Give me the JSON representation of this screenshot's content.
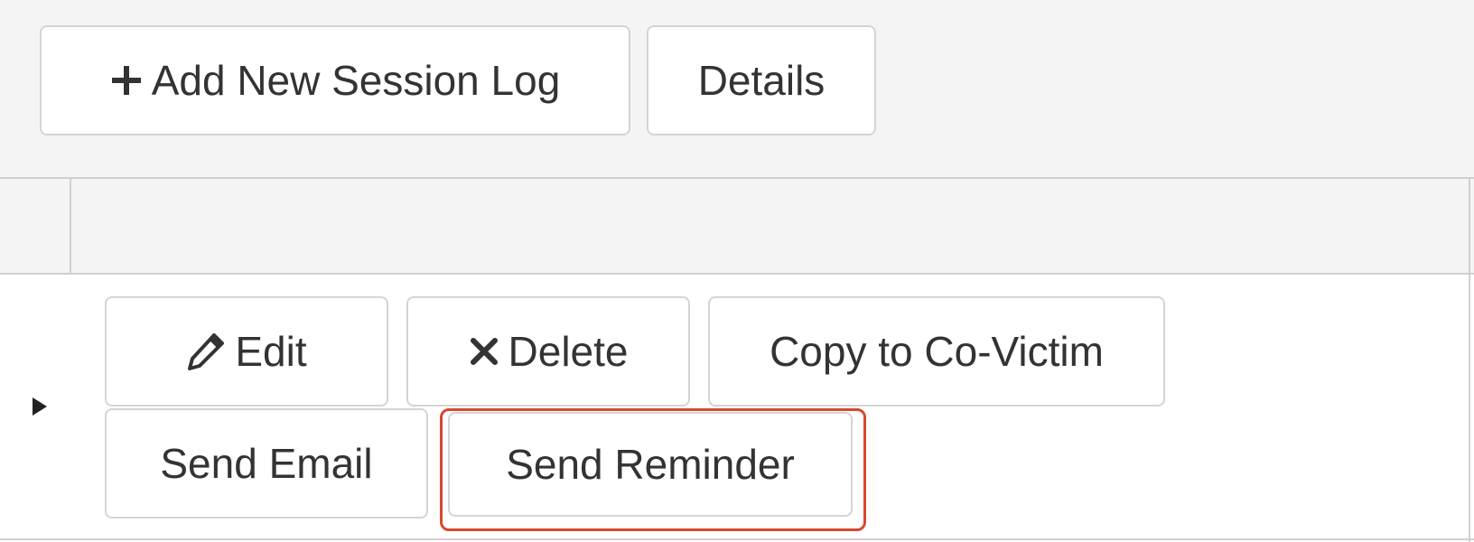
{
  "toolbar": {
    "add_session_label": "Add New Session Log",
    "add_session_icon": "plus-icon",
    "details_label": "Details"
  },
  "row": {
    "expand_icon": "caret-right-icon",
    "actions": {
      "edit_label": "Edit",
      "edit_icon": "pencil-icon",
      "delete_label": "Delete",
      "delete_icon": "close-icon",
      "copy_label": "Copy to Co-Victim",
      "send_email_label": "Send Email",
      "send_reminder_label": "Send Reminder"
    }
  },
  "highlight": {
    "target": "send-reminder-button",
    "color": "#d9472f"
  }
}
